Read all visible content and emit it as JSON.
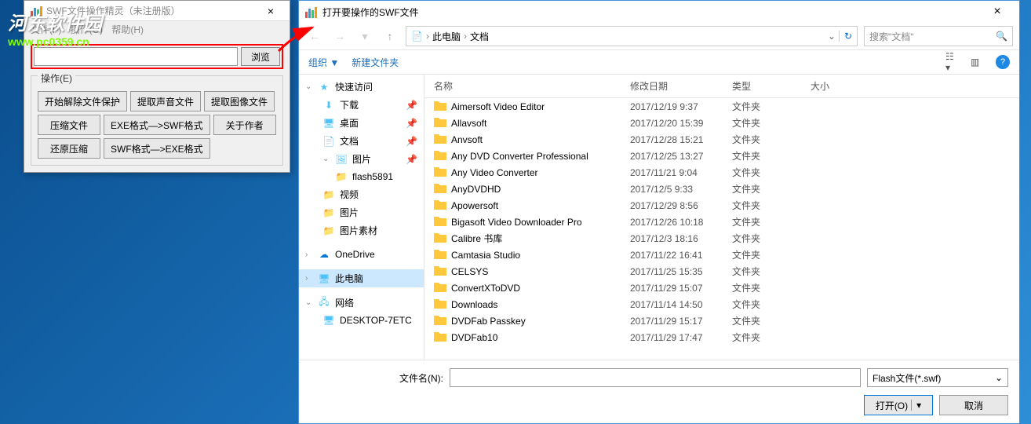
{
  "watermark": {
    "logo": "河东软件园",
    "url": "www.pc0359.cn"
  },
  "main": {
    "title": "SWF文件操作精灵（未注册版）",
    "menu": {
      "file": "文件(F)",
      "action": "操作(O)",
      "help": "帮助(H)"
    },
    "browse": "浏览",
    "ops_label": "操作(E)",
    "buttons": {
      "b1": "开始解除文件保护",
      "b2": "提取声音文件",
      "b3": "提取图像文件",
      "b4": "压缩文件",
      "b5": "EXE格式—>SWF格式",
      "b6": "关于作者",
      "b7": "还原压缩",
      "b8": "SWF格式—>EXE格式"
    }
  },
  "dialog": {
    "title": "打开要操作的SWF文件",
    "breadcrumb": {
      "p1": "此电脑",
      "p2": "文档"
    },
    "search_placeholder": "搜索\"文档\"",
    "toolbar": {
      "organize": "组织 ▼",
      "newfolder": "新建文件夹"
    },
    "tree": {
      "quick": "快速访问",
      "downloads": "下载",
      "desktop": "桌面",
      "documents": "文档",
      "pictures": "图片",
      "flash": "flash5891",
      "video": "视频",
      "pictures2": "图片",
      "pic_assets": "图片素材",
      "onedrive": "OneDrive",
      "thispc": "此电脑",
      "network": "网络",
      "pc_name": "DESKTOP-7ETC"
    },
    "headers": {
      "name": "名称",
      "date": "修改日期",
      "type": "类型",
      "size": "大小"
    },
    "files": [
      {
        "name": "Aimersoft Video Editor",
        "date": "2017/12/19 9:37",
        "type": "文件夹"
      },
      {
        "name": "Allavsoft",
        "date": "2017/12/20 15:39",
        "type": "文件夹"
      },
      {
        "name": "Anvsoft",
        "date": "2017/12/28 15:21",
        "type": "文件夹"
      },
      {
        "name": "Any DVD Converter Professional",
        "date": "2017/12/25 13:27",
        "type": "文件夹"
      },
      {
        "name": "Any Video Converter",
        "date": "2017/11/21 9:04",
        "type": "文件夹"
      },
      {
        "name": "AnyDVDHD",
        "date": "2017/12/5 9:33",
        "type": "文件夹"
      },
      {
        "name": "Apowersoft",
        "date": "2017/12/29 8:56",
        "type": "文件夹"
      },
      {
        "name": "Bigasoft Video Downloader Pro",
        "date": "2017/12/26 10:18",
        "type": "文件夹"
      },
      {
        "name": "Calibre 书库",
        "date": "2017/12/3 18:16",
        "type": "文件夹"
      },
      {
        "name": "Camtasia Studio",
        "date": "2017/11/22 16:41",
        "type": "文件夹"
      },
      {
        "name": "CELSYS",
        "date": "2017/11/25 15:35",
        "type": "文件夹"
      },
      {
        "name": "ConvertXToDVD",
        "date": "2017/11/29 15:07",
        "type": "文件夹"
      },
      {
        "name": "Downloads",
        "date": "2017/11/14 14:50",
        "type": "文件夹"
      },
      {
        "name": "DVDFab Passkey",
        "date": "2017/11/29 15:17",
        "type": "文件夹"
      },
      {
        "name": "DVDFab10",
        "date": "2017/11/29 17:47",
        "type": "文件夹"
      }
    ],
    "footer": {
      "fn_label": "文件名(N):",
      "filter": "Flash文件(*.swf)",
      "open": "打开(O)",
      "cancel": "取消"
    }
  }
}
